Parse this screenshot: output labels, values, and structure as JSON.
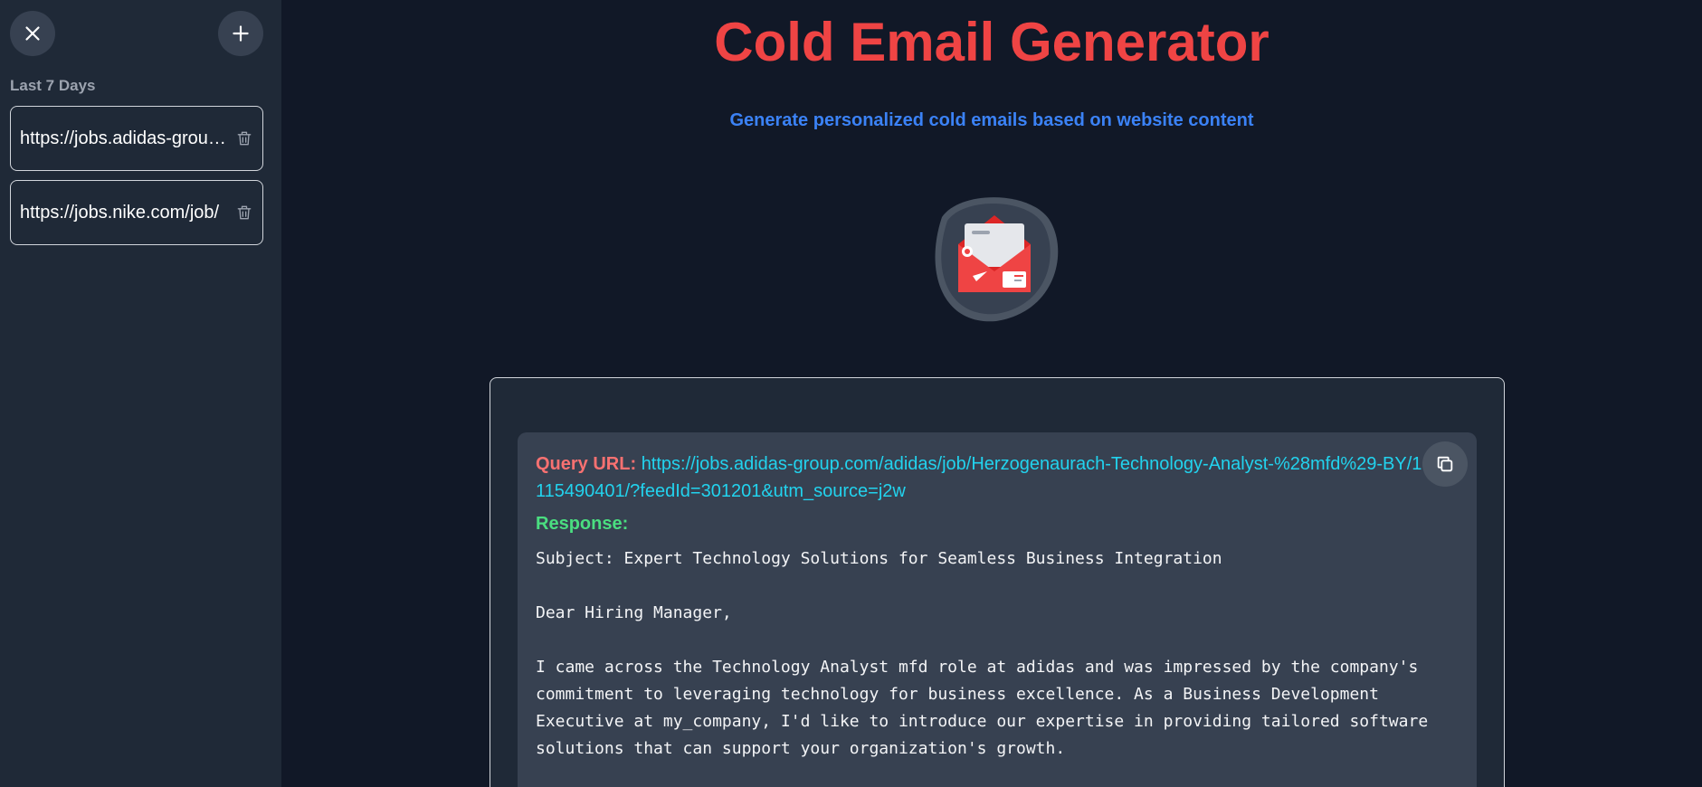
{
  "sidebar": {
    "section_label": "Last 7 Days",
    "history": [
      {
        "label": "https://jobs.adidas-group.com/adidas/job/Herzogenaurach-Technology-Analyst"
      },
      {
        "label": "https://jobs.nike.com/job/"
      }
    ]
  },
  "header": {
    "title": "Cold Email Generator",
    "subtitle": "Generate personalized cold emails based on website content"
  },
  "result": {
    "query_label": "Query URL:",
    "query_url": "https://jobs.adidas-group.com/adidas/job/Herzogenaurach-Technology-Analyst-%28mfd%29-BY/1115490401/?feedId=301201&utm_source=j2w",
    "response_label": "Response:",
    "email": "Subject: Expert Technology Solutions for Seamless Business Integration\n\nDear Hiring Manager,\n\nI came across the Technology Analyst mfd role at adidas and was impressed by the company's commitment to leveraging technology for business excellence. As a Business Development Executive at my_company, I'd like to introduce our expertise in providing tailored software solutions that can support your organization's growth."
  },
  "colors": {
    "accent_red": "#ef4444",
    "accent_blue": "#3b82f6",
    "url_cyan": "#22d3ee",
    "response_green": "#4ade80"
  },
  "icons": [
    "close-icon",
    "plus-icon",
    "trash-icon",
    "email-envelope-logo",
    "copy-icon"
  ]
}
